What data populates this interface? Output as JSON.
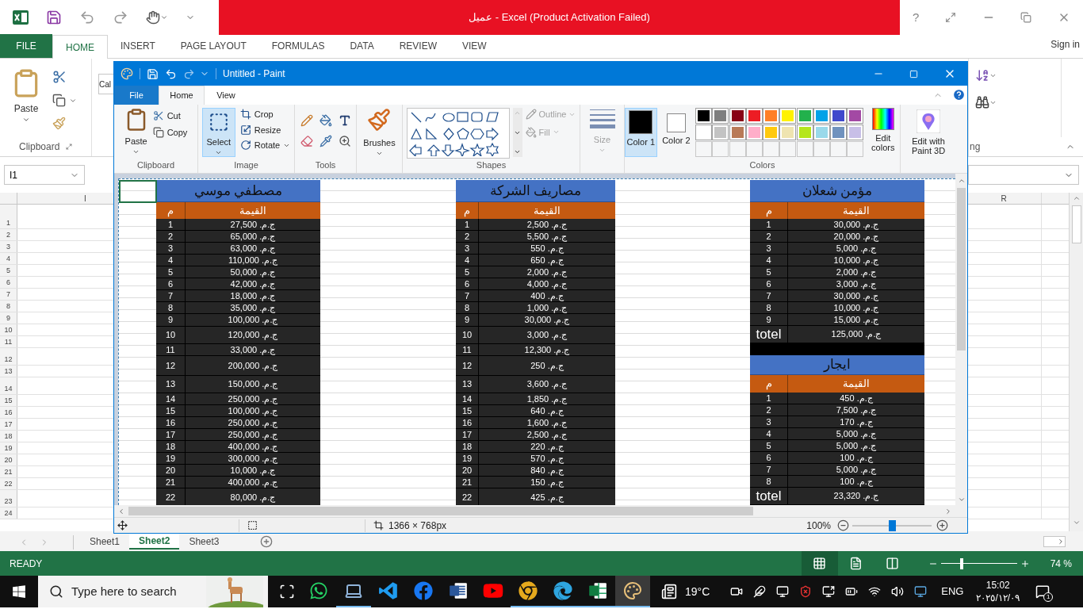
{
  "excel": {
    "title": "عميل - Excel (Product Activation Failed)",
    "help": "?",
    "sign_in": "Sign in",
    "tabs": [
      {
        "label": "VIEW",
        "kind": "tab",
        "selected": false
      },
      {
        "label": "REVIEW",
        "kind": "tab",
        "selected": false
      },
      {
        "label": "DATA",
        "kind": "tab",
        "selected": false
      },
      {
        "label": "FORMULAS",
        "kind": "tab",
        "selected": false
      },
      {
        "label": "PAGE LAYOUT",
        "kind": "tab",
        "selected": false
      },
      {
        "label": "INSERT",
        "kind": "tab",
        "selected": false
      },
      {
        "label": "HOME",
        "kind": "tab",
        "selected": true
      },
      {
        "label": "FILE",
        "kind": "file",
        "selected": false
      }
    ],
    "paste_label": "Paste",
    "clipboard_label": "Clipboard",
    "font_box": "Cal",
    "editing_label_part": "ng",
    "name_box": "I1",
    "columns": [
      "R",
      "I"
    ],
    "row_numbers": [
      "1",
      "2",
      "3",
      "4",
      "5",
      "6",
      "7",
      "8",
      "9",
      "10",
      "11",
      "12",
      "13",
      "14",
      "15",
      "16",
      "17",
      "18",
      "19",
      "20",
      "21",
      "22",
      "23",
      "24"
    ],
    "sheets": [
      {
        "label": "Sheet3",
        "selected": false
      },
      {
        "label": "Sheet2",
        "selected": true
      },
      {
        "label": "Sheet1",
        "selected": false
      }
    ],
    "status": "READY",
    "view_buttons": [
      {
        "kind": "normal",
        "selected": true
      },
      {
        "kind": "page-layout",
        "selected": false
      },
      {
        "kind": "page-break",
        "selected": false
      }
    ],
    "zoom": {
      "level": 0.25,
      "label": "74 %"
    }
  },
  "paint": {
    "title": "Untitled - Paint",
    "tabs": [
      {
        "label": "View",
        "kind": "tab",
        "selected": false
      },
      {
        "label": "Home",
        "kind": "tab",
        "selected": true
      },
      {
        "label": "File",
        "kind": "file",
        "selected": false
      }
    ],
    "clipboard": {
      "paste": "Paste",
      "cut": "Cut",
      "copy": "Copy",
      "label": "Clipboard"
    },
    "image": {
      "select": {
        "label": "Select",
        "selected": true
      },
      "crop": "Crop",
      "resize": "Resize",
      "rotate": "Rotate",
      "label": "Image"
    },
    "tools_label": "Tools",
    "brushes": "Brushes",
    "shapes": {
      "outline": {
        "label": "Outline",
        "disabled": true
      },
      "fill": {
        "label": "Fill",
        "disabled": true
      },
      "label": "Shapes"
    },
    "size": {
      "label": "Size",
      "disabled": true
    },
    "colors": {
      "color1": {
        "label": "Color 1",
        "color": "#000000",
        "selected": true
      },
      "color2": {
        "label": "Color 2",
        "color": "#ffffff",
        "selected": false
      },
      "edit": "Edit colors",
      "label": "Colors",
      "palette": [
        {
          "kind": "color",
          "color": "#000000"
        },
        {
          "kind": "color",
          "color": "#7f7f7f"
        },
        {
          "kind": "color",
          "color": "#880015"
        },
        {
          "kind": "color",
          "color": "#ed1c24"
        },
        {
          "kind": "color",
          "color": "#ff7f27"
        },
        {
          "kind": "color",
          "color": "#fff200"
        },
        {
          "kind": "color",
          "color": "#22b14c"
        },
        {
          "kind": "color",
          "color": "#00a2e8"
        },
        {
          "kind": "color",
          "color": "#3f48cc"
        },
        {
          "kind": "color",
          "color": "#a349a4"
        },
        {
          "kind": "color",
          "color": "#ffffff"
        },
        {
          "kind": "color",
          "color": "#c3c3c3"
        },
        {
          "kind": "color",
          "color": "#b97a57"
        },
        {
          "kind": "color",
          "color": "#ffaec9"
        },
        {
          "kind": "color",
          "color": "#ffc90e"
        },
        {
          "kind": "color",
          "color": "#efe4b0"
        },
        {
          "kind": "color",
          "color": "#b5e61d"
        },
        {
          "kind": "color",
          "color": "#99d9ea"
        },
        {
          "kind": "color",
          "color": "#7092be"
        },
        {
          "kind": "color",
          "color": "#c8bfe7"
        },
        {
          "kind": "empty"
        },
        {
          "kind": "empty"
        },
        {
          "kind": "empty"
        },
        {
          "kind": "empty"
        },
        {
          "kind": "empty"
        },
        {
          "kind": "empty"
        },
        {
          "kind": "empty"
        },
        {
          "kind": "empty"
        },
        {
          "kind": "empty"
        },
        {
          "kind": "empty"
        }
      ]
    },
    "paint3d": "Edit with Paint 3D",
    "canvas": {
      "stacks": [
        {
          "tables": [
            {
              "title": "مؤمن شعلان",
              "columns": [
                "القيمة",
                "م"
              ],
              "rows": [
                {
                  "kind": "item",
                  "value": "ج.م. 30,000",
                  "no": "1"
                },
                {
                  "kind": "item",
                  "value": "ج.م. 20,000",
                  "no": "2"
                },
                {
                  "kind": "item",
                  "value": "ج.م. 5,000",
                  "no": "3"
                },
                {
                  "kind": "item",
                  "value": "ج.م. 10,000",
                  "no": "4"
                },
                {
                  "kind": "item",
                  "value": "ج.م. 2,000",
                  "no": "5"
                },
                {
                  "kind": "item",
                  "value": "ج.م. 3,000",
                  "no": "6"
                },
                {
                  "kind": "item",
                  "value": "ج.م. 30,000",
                  "no": "7"
                },
                {
                  "kind": "item",
                  "value": "ج.م. 10,000",
                  "no": "8"
                },
                {
                  "kind": "item",
                  "value": "ج.م. 15,000",
                  "no": "9"
                },
                {
                  "kind": "total",
                  "value": "ج.م. 125,000",
                  "no": "totel"
                }
              ]
            },
            {
              "title": "ايجار",
              "columns": [
                "القيمة",
                "م"
              ],
              "rows": [
                {
                  "kind": "item",
                  "value": "ج.م. 450",
                  "no": "1"
                },
                {
                  "kind": "item",
                  "value": "ج.م. 7,500",
                  "no": "2"
                },
                {
                  "kind": "item",
                  "value": "ج.م. 170",
                  "no": "3"
                },
                {
                  "kind": "item",
                  "value": "ج.م. 5,000",
                  "no": "4"
                },
                {
                  "kind": "item",
                  "value": "ج.م. 5,000",
                  "no": "5"
                },
                {
                  "kind": "item",
                  "value": "ج.م. 100",
                  "no": "6"
                },
                {
                  "kind": "item",
                  "value": "ج.م. 5,000",
                  "no": "7"
                },
                {
                  "kind": "item",
                  "value": "ج.م. 100",
                  "no": "8"
                },
                {
                  "kind": "total",
                  "value": "ج.م. 23,320",
                  "no": "totel"
                }
              ]
            }
          ]
        },
        {
          "tables": [
            {
              "title": "مصاريف الشركة",
              "columns": [
                "القيمة",
                "م"
              ],
              "rows": [
                {
                  "kind": "item",
                  "value": "ج.م. 2,500",
                  "no": "1"
                },
                {
                  "kind": "item",
                  "value": "ج.م. 5,500",
                  "no": "2"
                },
                {
                  "kind": "item",
                  "value": "ج.م. 550",
                  "no": "3"
                },
                {
                  "kind": "item",
                  "value": "ج.م. 650",
                  "no": "4"
                },
                {
                  "kind": "item",
                  "value": "ج.م. 2,000",
                  "no": "5"
                },
                {
                  "kind": "item",
                  "value": "ج.م. 4,000",
                  "no": "6"
                },
                {
                  "kind": "item",
                  "value": "ج.م. 400",
                  "no": "7"
                },
                {
                  "kind": "item",
                  "value": "ج.م. 1,000",
                  "no": "8"
                },
                {
                  "kind": "item",
                  "value": "ج.م. 30,000",
                  "no": "9"
                },
                {
                  "kind": "item",
                  "value": "ج.م. 3,000",
                  "no": "10"
                },
                {
                  "kind": "item",
                  "value": "ج.م. 12,300",
                  "no": "11"
                },
                {
                  "kind": "item",
                  "value": "ج.م. 250",
                  "no": "12"
                },
                {
                  "kind": "item",
                  "value": "ج.م. 3,600",
                  "no": "13"
                },
                {
                  "kind": "item",
                  "value": "ج.م. 1,850",
                  "no": "14"
                },
                {
                  "kind": "item",
                  "value": "ج.م. 640",
                  "no": "15"
                },
                {
                  "kind": "item",
                  "value": "ج.م. 1,600",
                  "no": "16"
                },
                {
                  "kind": "item",
                  "value": "ج.م. 2,500",
                  "no": "17"
                },
                {
                  "kind": "item",
                  "value": "ج.م. 220",
                  "no": "18"
                },
                {
                  "kind": "item",
                  "value": "ج.م. 570",
                  "no": "19"
                },
                {
                  "kind": "item",
                  "value": "ج.م. 840",
                  "no": "20"
                },
                {
                  "kind": "item",
                  "value": "ج.م. 150",
                  "no": "21"
                },
                {
                  "kind": "item",
                  "value": "ج.م. 425",
                  "no": "22"
                }
              ]
            }
          ]
        },
        {
          "tables": [
            {
              "title": "مصطفي موسي",
              "columns": [
                "القيمة",
                "م"
              ],
              "rows": [
                {
                  "kind": "item",
                  "value": "ج.م. 27,500",
                  "no": "1"
                },
                {
                  "kind": "item",
                  "value": "ج.م. 65,000",
                  "no": "2"
                },
                {
                  "kind": "item",
                  "value": "ج.م. 63,000",
                  "no": "3"
                },
                {
                  "kind": "item",
                  "value": "ج.م. 110,000",
                  "no": "4"
                },
                {
                  "kind": "item",
                  "value": "ج.م. 50,000",
                  "no": "5"
                },
                {
                  "kind": "item",
                  "value": "ج.م. 42,000",
                  "no": "6"
                },
                {
                  "kind": "item",
                  "value": "ج.م. 18,000",
                  "no": "7"
                },
                {
                  "kind": "item",
                  "value": "ج.م. 35,000",
                  "no": "8"
                },
                {
                  "kind": "item",
                  "value": "ج.م. 100,000",
                  "no": "9"
                },
                {
                  "kind": "item",
                  "value": "ج.م. 120,000",
                  "no": "10"
                },
                {
                  "kind": "item",
                  "value": "ج.م. 33,000",
                  "no": "11"
                },
                {
                  "kind": "item",
                  "value": "ج.م. 200,000",
                  "no": "12"
                },
                {
                  "kind": "item",
                  "value": "ج.م. 150,000",
                  "no": "13"
                },
                {
                  "kind": "item",
                  "value": "ج.م. 250,000",
                  "no": "14"
                },
                {
                  "kind": "item",
                  "value": "ج.م. 100,000",
                  "no": "15"
                },
                {
                  "kind": "item",
                  "value": "ج.م. 250,000",
                  "no": "16"
                },
                {
                  "kind": "item",
                  "value": "ج.م. 250,000",
                  "no": "17"
                },
                {
                  "kind": "item",
                  "value": "ج.م. 400,000",
                  "no": "18"
                },
                {
                  "kind": "item",
                  "value": "ج.م. 300,000",
                  "no": "19"
                },
                {
                  "kind": "item",
                  "value": "ج.م. 10,000",
                  "no": "20"
                },
                {
                  "kind": "item",
                  "value": "ج.م. 400,000",
                  "no": "21"
                },
                {
                  "kind": "item",
                  "value": "ج.م. 80,000",
                  "no": "22"
                }
              ]
            }
          ]
        }
      ]
    },
    "status": {
      "size": "1366 × 768px",
      "zoom": "100%",
      "zoom_level": {
        "level": 0.5
      }
    }
  },
  "taskbar": {
    "search_placeholder": "Type here to search",
    "apps": [
      {
        "kind": "whatsapp",
        "running": false,
        "active": false
      },
      {
        "kind": "computer",
        "running": true,
        "active": false
      },
      {
        "kind": "code",
        "running": false,
        "active": false
      },
      {
        "kind": "facebook",
        "running": false,
        "active": false
      },
      {
        "kind": "word",
        "running": false,
        "active": false
      },
      {
        "kind": "youtube",
        "running": false,
        "active": false
      },
      {
        "kind": "chrome",
        "running": true,
        "active": false
      },
      {
        "kind": "edge",
        "running": true,
        "active": false
      },
      {
        "kind": "excel",
        "running": true,
        "active": false
      },
      {
        "kind": "paint",
        "running": true,
        "active": true
      }
    ],
    "temperature": "19°C",
    "language": "ENG",
    "time": "15:02",
    "date": "٢٠٢٥/١٢/٠٩",
    "notifications": "1"
  }
}
